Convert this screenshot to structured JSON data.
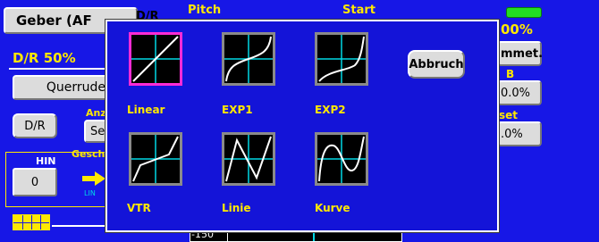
{
  "header": {
    "title_button": "Geber (AF",
    "title_overflow": "D/R",
    "col2_label": "Pitch",
    "col3_label": "Start"
  },
  "left": {
    "dr_value": "D/R 50%",
    "channel_button": "Querrude",
    "dr_button": "D/R",
    "anz_label": "Anz",
    "se_button": "Se",
    "gesch_label": "Gesch",
    "hin_label": "HIN",
    "hin_value": "0",
    "lin_tag": "LIN"
  },
  "right": {
    "pct_top": "00%",
    "symm_button": "mmet.",
    "b_label": "B",
    "value1": "0.0%",
    "set_label": "set",
    "value2": ".0%"
  },
  "bottom": {
    "scale_min": "-150"
  },
  "modal": {
    "cancel_button": "Abbruch",
    "curves": [
      {
        "label": "Linear",
        "icon": "linear-curve-icon",
        "selected": true
      },
      {
        "label": "EXP1",
        "icon": "exp1-curve-icon",
        "selected": false
      },
      {
        "label": "EXP2",
        "icon": "exp2-curve-icon",
        "selected": false
      },
      {
        "label": "VTR",
        "icon": "vtr-curve-icon",
        "selected": false
      },
      {
        "label": "Linie",
        "icon": "linie-curve-icon",
        "selected": false
      },
      {
        "label": "Kurve",
        "icon": "kurve-curve-icon",
        "selected": false
      }
    ]
  },
  "colors": {
    "background": "#1717e6",
    "accent_yellow": "#ffe800",
    "selection": "#ff2bd6",
    "grid_cyan": "#00d8e6",
    "battery_green": "#22dd22"
  }
}
